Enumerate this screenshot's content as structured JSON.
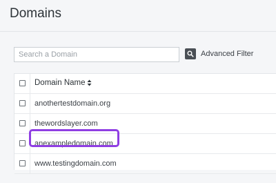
{
  "page": {
    "title": "Domains"
  },
  "search": {
    "placeholder": "Search a Domain",
    "value": "",
    "button_icon": "search-icon",
    "advanced_filter_label": "Advanced Filter"
  },
  "table": {
    "header": {
      "domain_name_label": "Domain Name",
      "sort_icon": "sort-icon"
    },
    "rows": [
      {
        "domain": "anothertestdomain.org"
      },
      {
        "domain": "thewordslayer.com"
      },
      {
        "domain": "anexampledomain.com",
        "highlighted": true
      },
      {
        "domain": "www.testingdomain.com"
      }
    ]
  },
  "colors": {
    "highlight": "#8f3ee3",
    "search_button": "#4a4f55"
  }
}
